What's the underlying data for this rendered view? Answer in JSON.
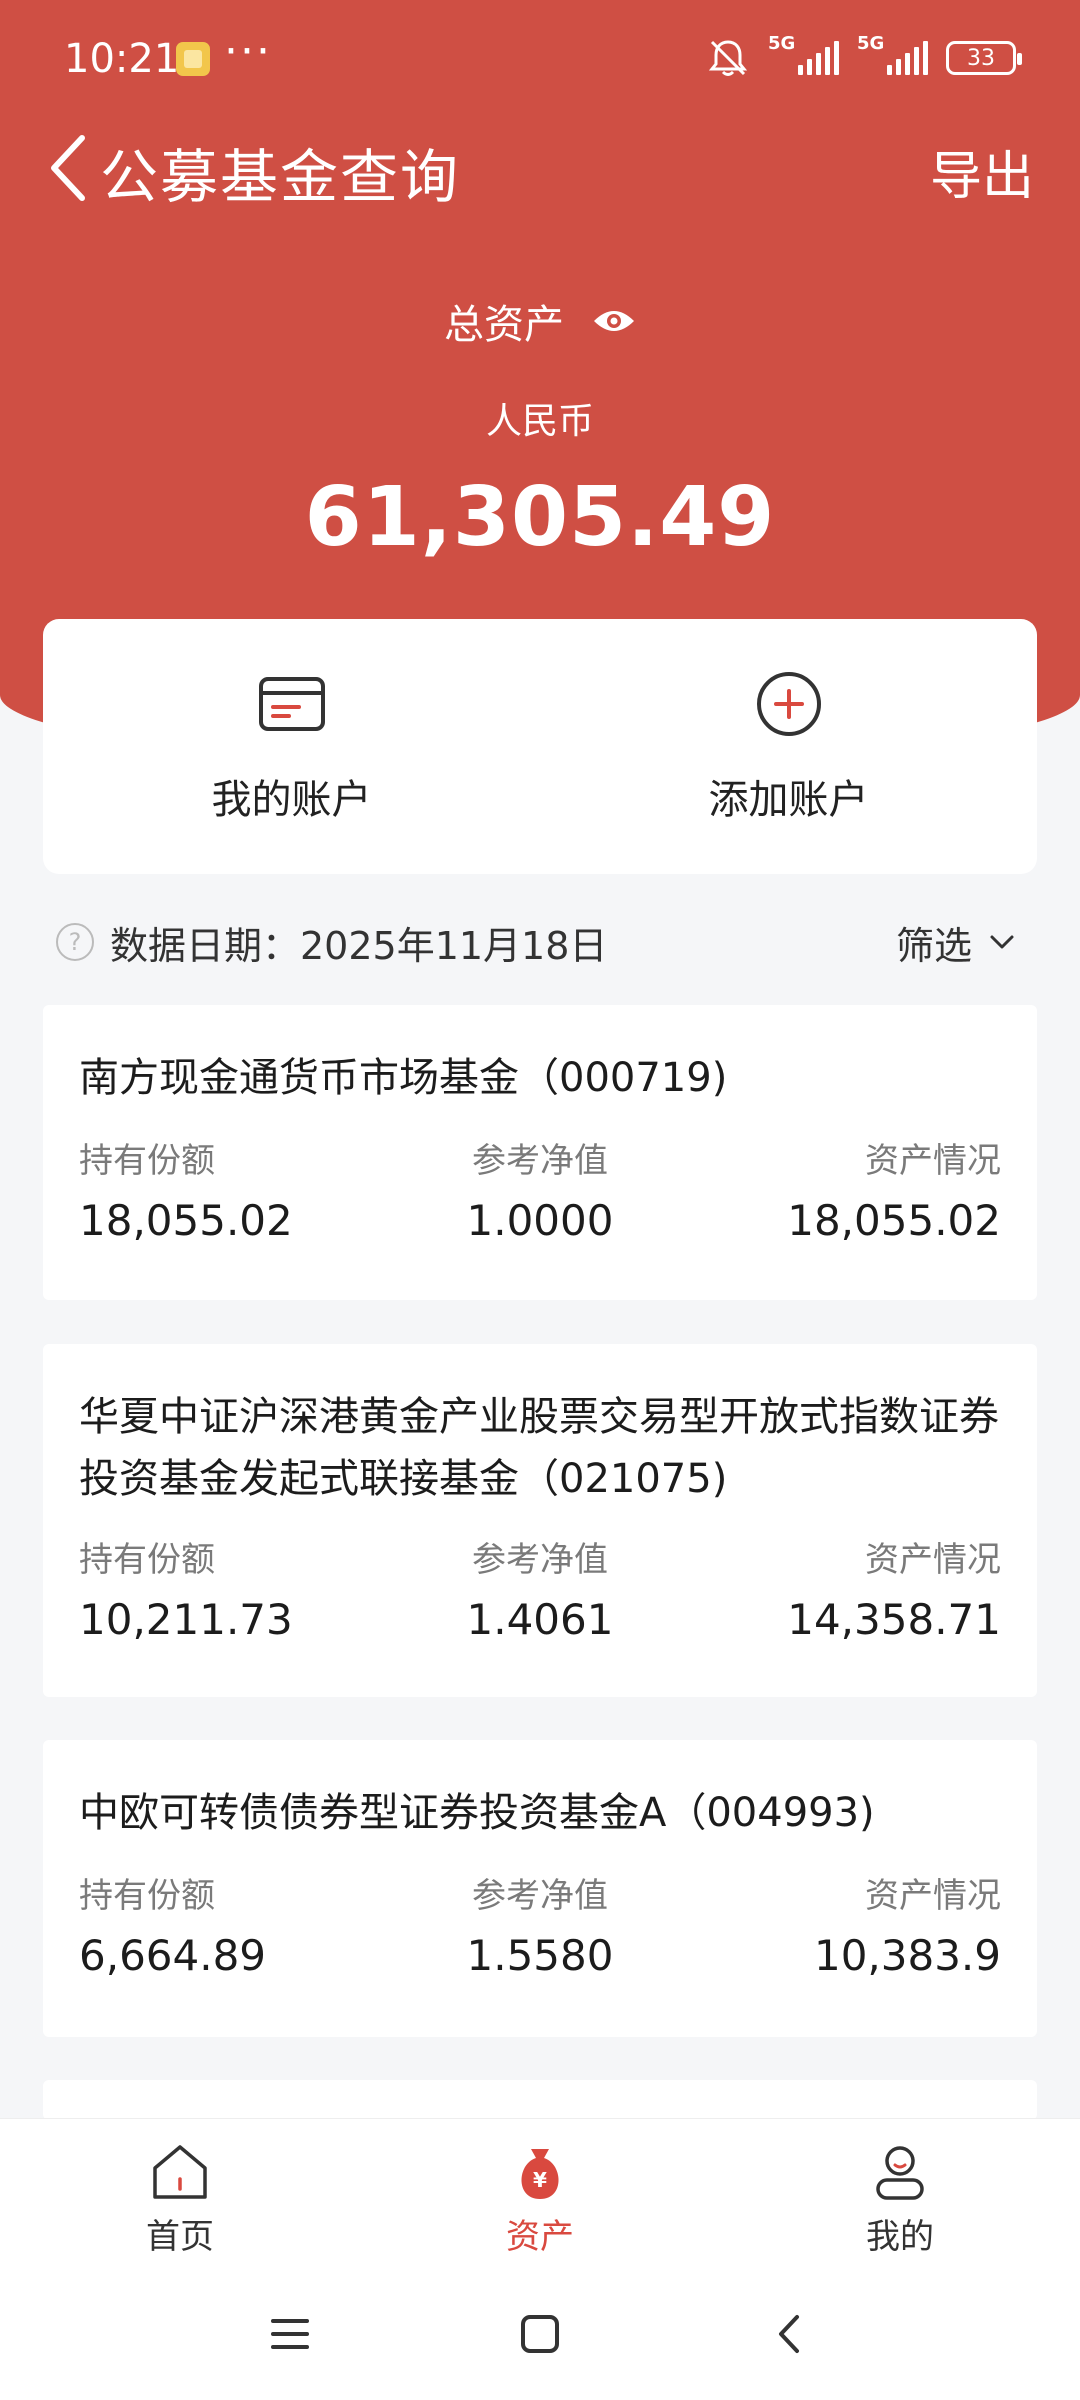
{
  "status_bar": {
    "time": "10:21",
    "dots": "···",
    "signal_1": "5G",
    "signal_2": "5G",
    "battery": "33"
  },
  "nav": {
    "title": "公募基金查询",
    "export": "导出"
  },
  "summary": {
    "label": "总资产",
    "currency": "人民币",
    "total": "61,305.49"
  },
  "account_actions": [
    {
      "label": "我的账户",
      "icon": "card-icon"
    },
    {
      "label": "添加账户",
      "icon": "plus-circle-icon"
    }
  ],
  "data_date": {
    "text": "数据日期：2025年11月18日",
    "filter": "筛选"
  },
  "column_headers": {
    "shares": "持有份额",
    "nav": "参考净值",
    "asset": "资产情况"
  },
  "funds": [
    {
      "name": "南方现金通货币市场基金（000719)",
      "shares": "18,055.02",
      "nav": "1.0000",
      "asset": "18,055.02"
    },
    {
      "name": "华夏中证沪深港黄金产业股票交易型开放式指数证券投资基金发起式联接基金（021075)",
      "shares": "10,211.73",
      "nav": "1.4061",
      "asset": "14,358.71"
    },
    {
      "name": "中欧可转债债券型证券投资基金A（004993)",
      "shares": "6,664.89",
      "nav": "1.5580",
      "asset": "10,383.9"
    }
  ],
  "tabs": [
    {
      "label": "首页",
      "icon": "home-icon"
    },
    {
      "label": "资产",
      "icon": "money-bag-icon",
      "active": true
    },
    {
      "label": "我的",
      "icon": "person-icon"
    }
  ],
  "colors": {
    "brand": "#cf4f44",
    "active_tab": "#d9493f",
    "background": "#f5f6f8"
  }
}
